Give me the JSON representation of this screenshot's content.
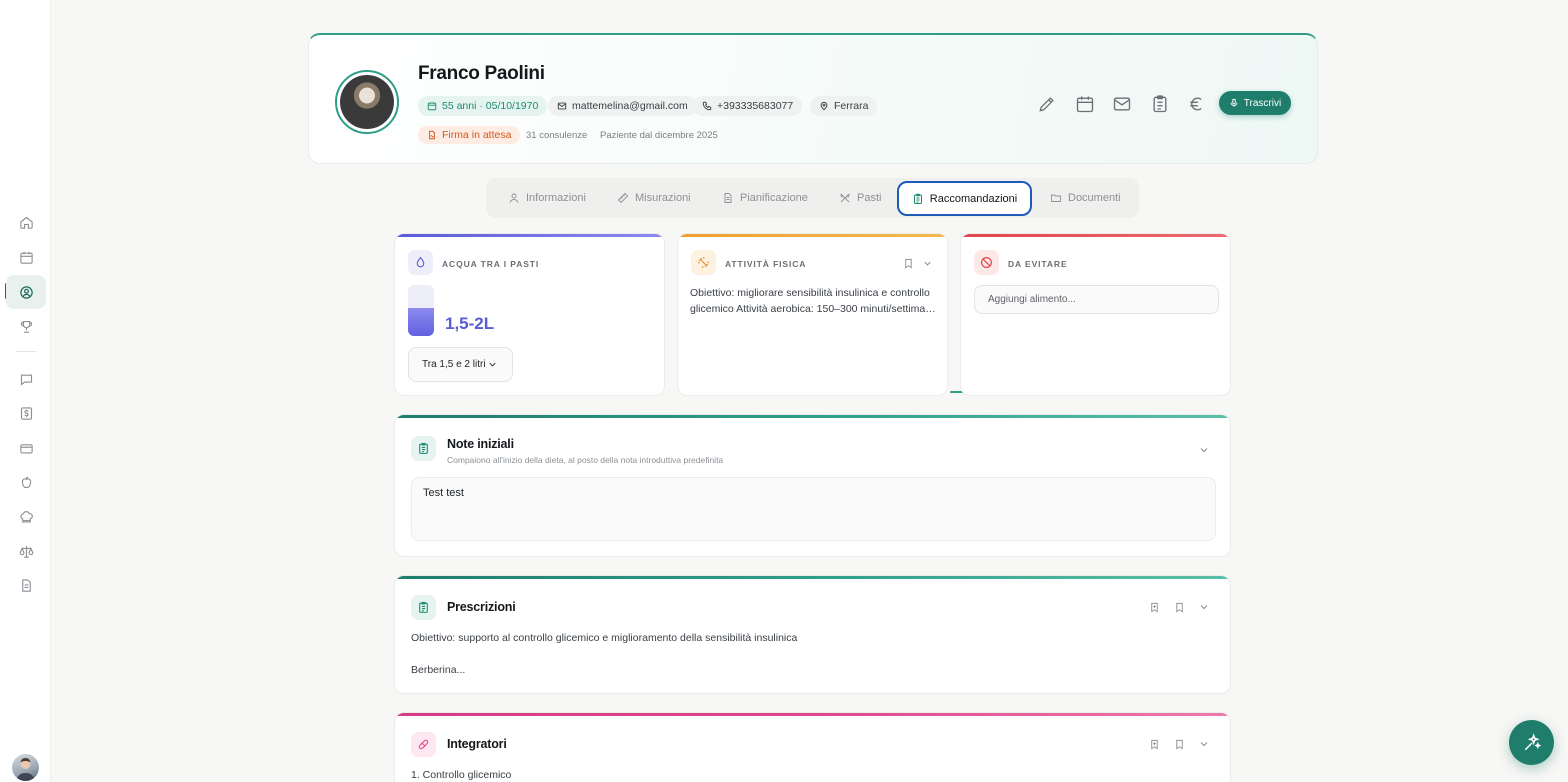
{
  "patient": {
    "name": "Franco Paolini",
    "age_dob": "55 anni · 05/10/1970",
    "email": "mattemelina@gmail.com",
    "phone": "+393335683077",
    "city": "Ferrara",
    "status": "Firma in attesa",
    "consultations": "31 consulenze",
    "since": "Paziente dal dicembre 2025"
  },
  "header_actions": {
    "transcribe_label": "Trascrivi",
    "icons": [
      "pencil-icon",
      "calendar-icon",
      "mail-icon",
      "clipboard-icon",
      "euro-icon"
    ]
  },
  "tabs": [
    {
      "label": "Informazioni",
      "icon": "user-icon"
    },
    {
      "label": "Misurazioni",
      "icon": "ruler-icon"
    },
    {
      "label": "Pianificazione",
      "icon": "file-icon"
    },
    {
      "label": "Pasti",
      "icon": "utensils-icon"
    },
    {
      "label": "Raccomandazioni",
      "icon": "clipboard-icon",
      "active": true
    },
    {
      "label": "Documenti",
      "icon": "folder-icon"
    }
  ],
  "water": {
    "label": "ACQUA TRA I PASTI",
    "value": "1,5-2L",
    "fill_fraction": 0.55,
    "select_value": "Tra 1,5 e 2 litri",
    "color": "#5b5bd6"
  },
  "activity": {
    "label": "ATTIVITÀ FISICA",
    "line1": "Obiettivo: migliorare sensibilità insulinica e controllo",
    "line2": "glicemico Attività aerobica: 150–300 minuti/settimana...",
    "color": "#f0a030"
  },
  "avoid": {
    "label": "DA EVITARE",
    "placeholder": "Aggiungi alimento...",
    "color": "#e0474c"
  },
  "notes": {
    "title": "Note iniziali",
    "subtitle": "Compaiono all'inizio della dieta, al posto della nota introduttiva predefinita",
    "value": "Test test"
  },
  "prescriptions": {
    "title": "Prescrizioni",
    "line1": "Obiettivo: supporto al controllo glicemico e miglioramento della sensibilità insulinica",
    "line2": "Berberina..."
  },
  "supplements": {
    "title": "Integratori",
    "line1": "1. Controllo glicemico",
    "color": "#e0468a"
  },
  "colors": {
    "brand": "#1f7d6c",
    "accent_teal": "#2e9e87",
    "active_tab_border": "#1e5bb8"
  }
}
